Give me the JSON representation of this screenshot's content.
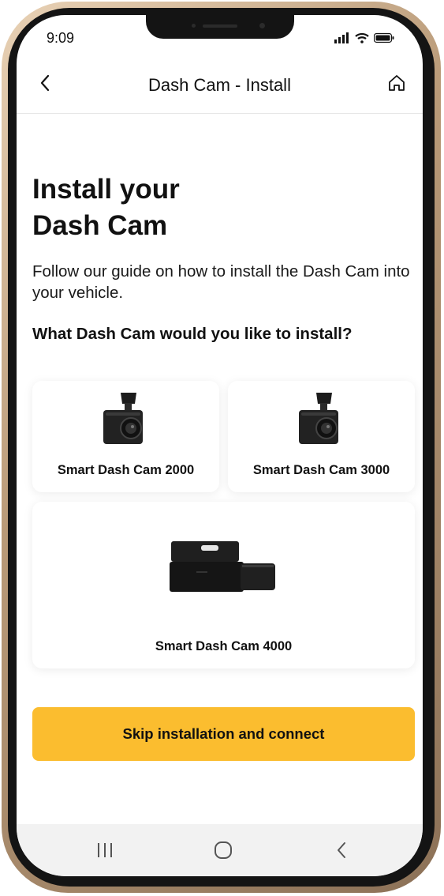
{
  "status_bar": {
    "time": "9:09",
    "icons": [
      "signal-icon",
      "wifi-icon",
      "battery-icon"
    ]
  },
  "header": {
    "title": "Dash Cam - Install",
    "back_icon": "chevron-left-icon",
    "home_icon": "home-icon"
  },
  "main": {
    "title_line1": "Install your",
    "title_line2": "Dash Cam",
    "description": "Follow our guide on how to install the Dash Cam into your vehicle.",
    "question": "What Dash Cam would you like to install?",
    "options": [
      {
        "label": "Smart Dash Cam 2000",
        "image": "dash-cam-compact"
      },
      {
        "label": "Smart Dash Cam 3000",
        "image": "dash-cam-compact"
      },
      {
        "label": "Smart Dash Cam 4000",
        "image": "dash-cam-wide"
      }
    ],
    "skip_button": "Skip installation and connect"
  },
  "nav_bar": {
    "icons": [
      "recents-icon",
      "home-circle-icon",
      "back-icon"
    ]
  },
  "colors": {
    "accent": "#fbbd2f",
    "text": "#111111",
    "nav_background": "#f2f2f2",
    "frame": "#b99a78"
  }
}
